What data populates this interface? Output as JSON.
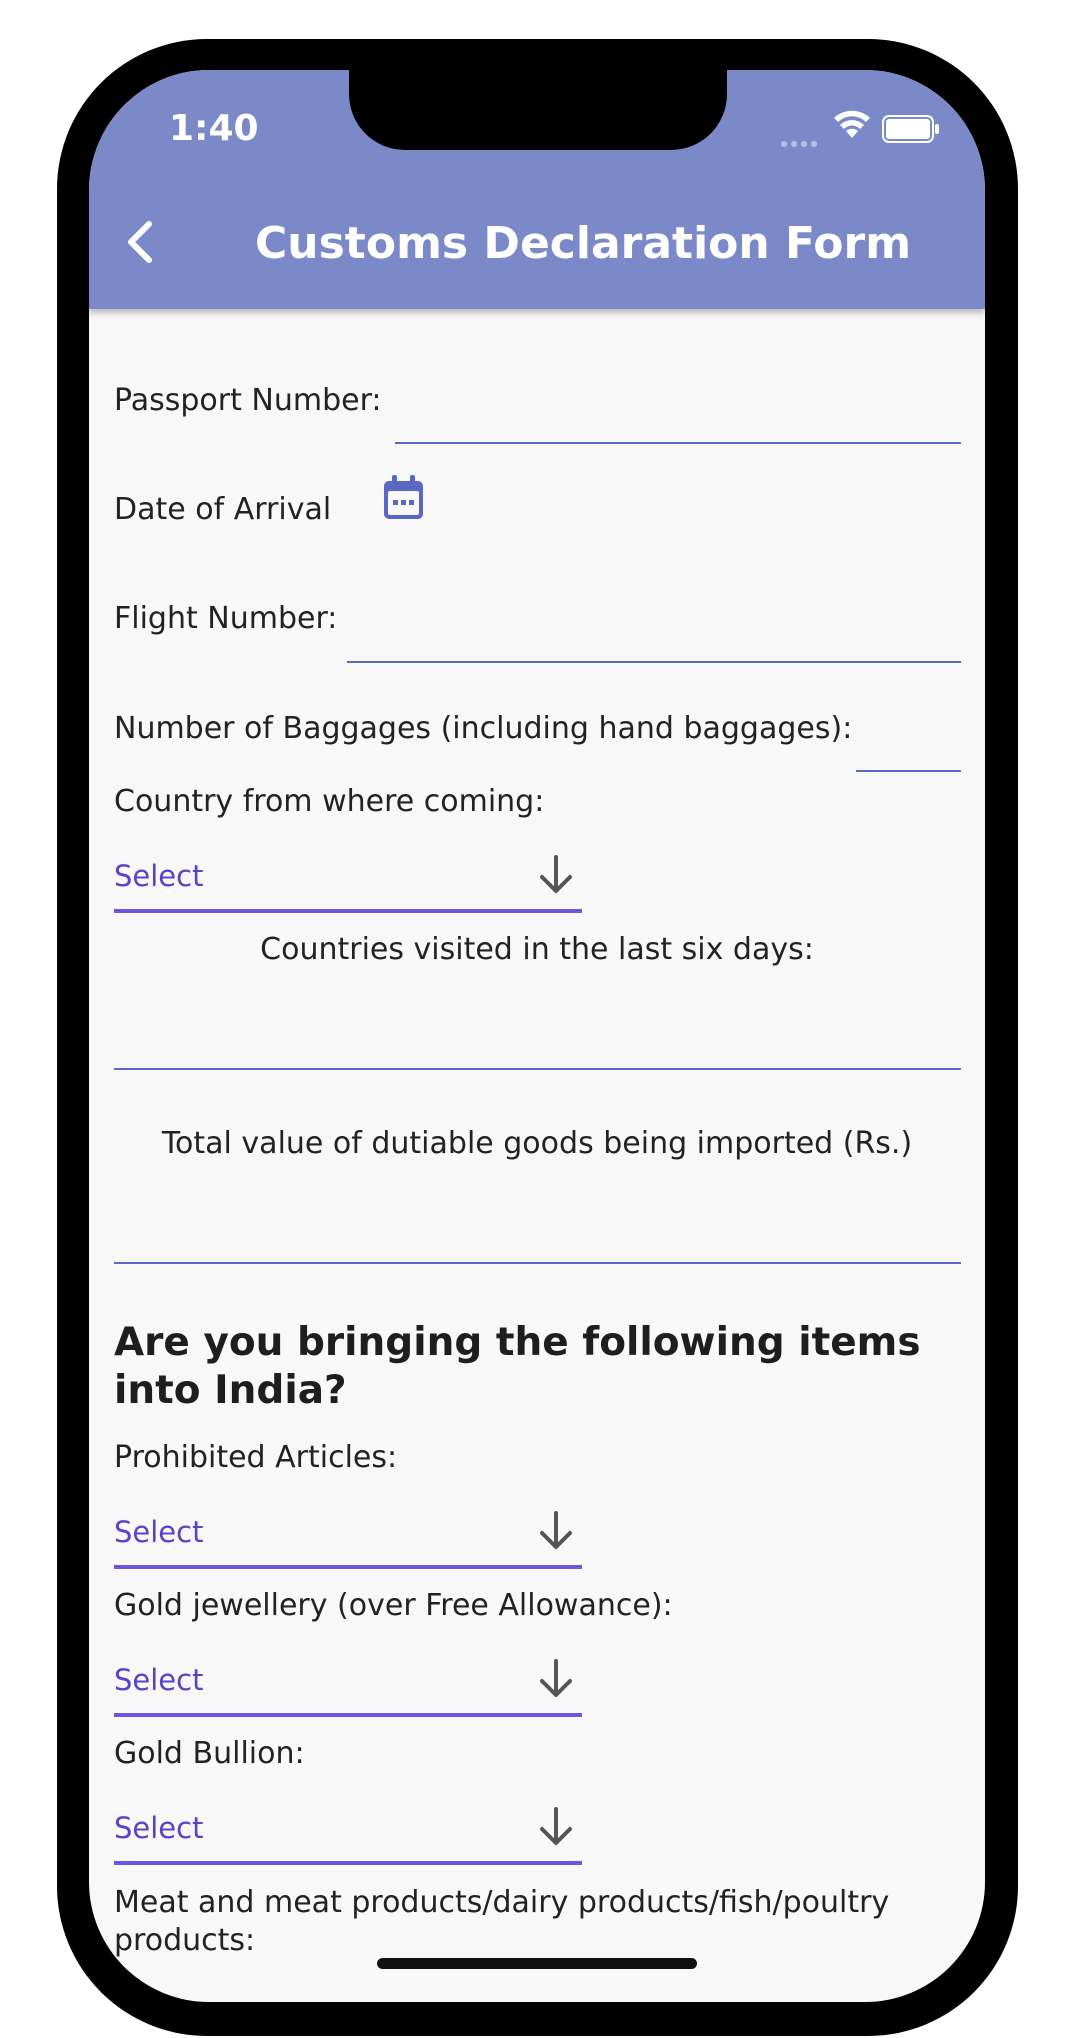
{
  "status_bar": {
    "time": "1:40"
  },
  "app_bar": {
    "title": "Customs Declaration Form",
    "back_icon": "chevron-left-icon"
  },
  "form": {
    "passport_label": "Passport Number:",
    "passport_value": "",
    "arrival_label": "Date of Arrival",
    "flight_label": "Flight Number:",
    "flight_value": "",
    "baggages_label": "Number of Baggages (including hand baggages):",
    "baggages_value": "",
    "country_label": "Country from where coming:",
    "country_select": "Select",
    "visited_label": "Countries visited in the last six days:",
    "visited_value": "",
    "dutiable_label": "Total value of dutiable goods being imported (Rs.)",
    "dutiable_value": ""
  },
  "items_section": {
    "heading": "Are you bringing the following items into India?",
    "prohibited_label": "Prohibited Articles:",
    "prohibited_select": "Select",
    "gold_jewellery_label": "Gold jewellery (over Free Allowance):",
    "gold_jewellery_select": "Select",
    "gold_bullion_label": "Gold Bullion:",
    "gold_bullion_select": "Select",
    "meat_label": "Meat and meat products/dairy products/fish/poultry products:"
  },
  "colors": {
    "app_bar": "#7c89c8",
    "underline": "#5a67c3",
    "dropdown_accent": "#6b57e0",
    "select_text": "#5b40c9"
  }
}
